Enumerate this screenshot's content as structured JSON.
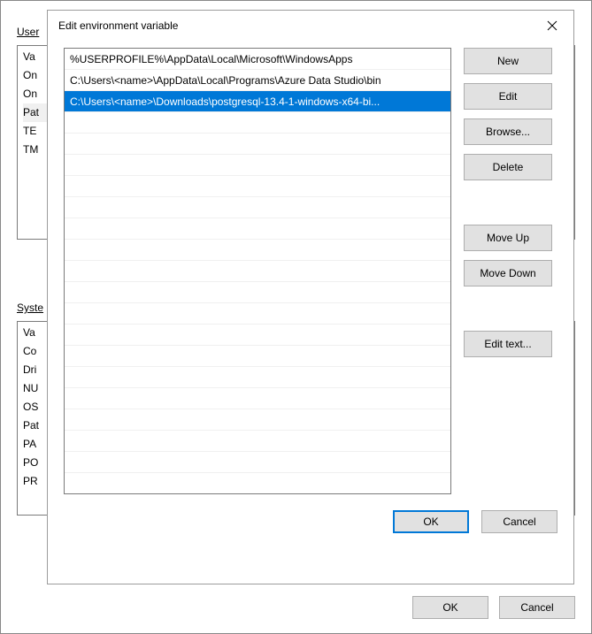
{
  "background": {
    "user_label_prefix": "User",
    "user_items": [
      "Va",
      "On",
      "On",
      "Pat",
      "TE",
      "TM"
    ],
    "system_label_prefix": "Syste",
    "system_items": [
      "Va",
      "Co",
      "Dri",
      "NU",
      "OS",
      "Pat",
      "PA",
      "PO",
      "PR"
    ],
    "ok_label": "OK",
    "cancel_label": "Cancel"
  },
  "dialog": {
    "title": "Edit environment variable",
    "list_items": [
      {
        "text": "%USERPROFILE%\\AppData\\Local\\Microsoft\\WindowsApps",
        "selected": false
      },
      {
        "text": "C:\\Users\\<name>\\AppData\\Local\\Programs\\Azure Data Studio\\bin",
        "selected": false
      },
      {
        "text": "C:\\Users\\<name>\\Downloads\\postgresql-13.4-1-windows-x64-bi...",
        "selected": true
      }
    ],
    "buttons": {
      "new": "New",
      "edit": "Edit",
      "browse": "Browse...",
      "delete": "Delete",
      "move_up": "Move Up",
      "move_down": "Move Down",
      "edit_text": "Edit text..."
    },
    "ok_label": "OK",
    "cancel_label": "Cancel"
  }
}
